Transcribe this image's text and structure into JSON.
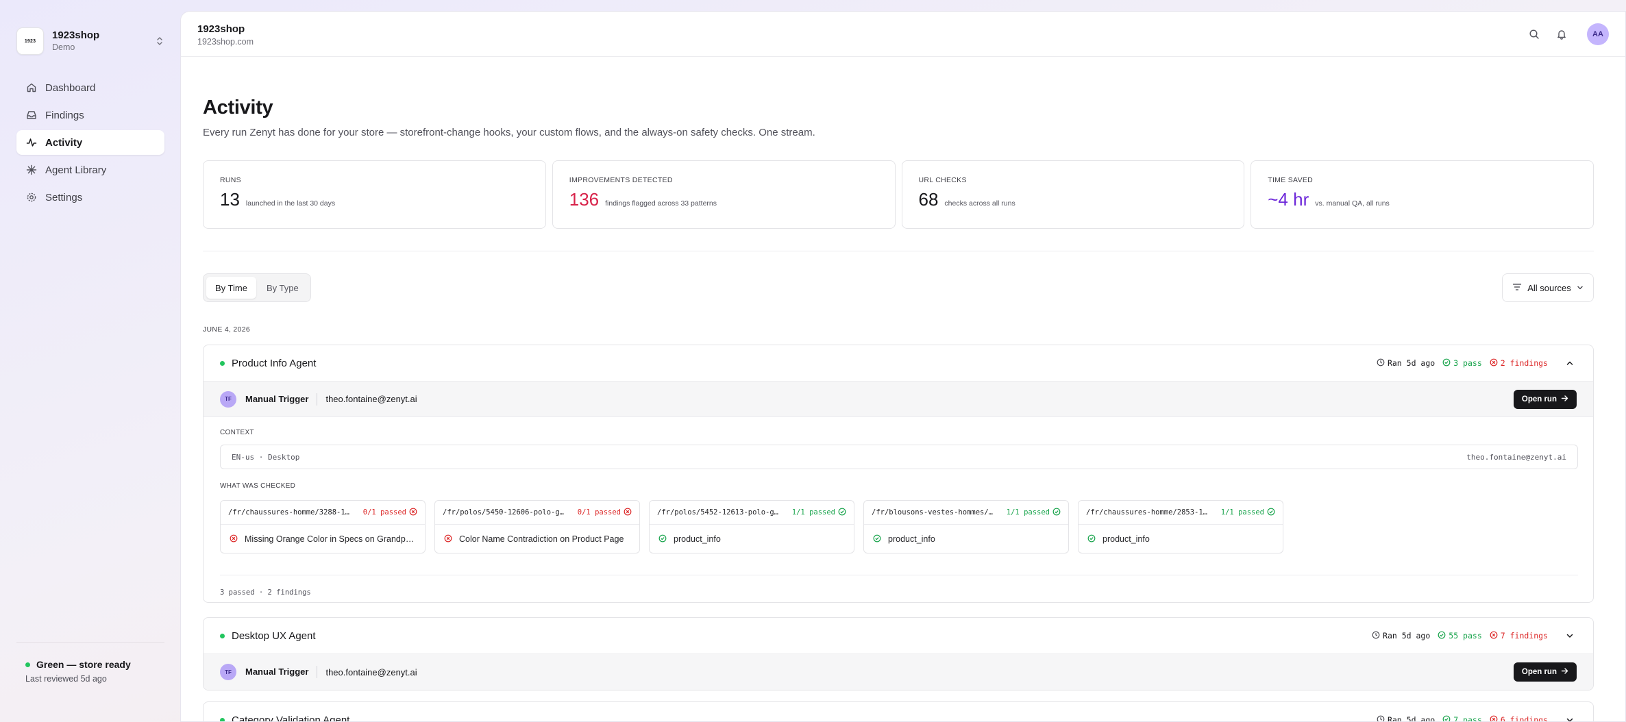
{
  "sidebar": {
    "shop_logo_text": "1923",
    "shop_name": "1923shop",
    "shop_env": "Demo",
    "items": [
      {
        "label": "Dashboard",
        "icon": "home-icon"
      },
      {
        "label": "Findings",
        "icon": "inbox-icon"
      },
      {
        "label": "Activity",
        "icon": "activity-icon",
        "active": true
      },
      {
        "label": "Agent Library",
        "icon": "agent-icon"
      },
      {
        "label": "Settings",
        "icon": "gear-icon"
      }
    ],
    "status_title": "Green — store ready",
    "status_sub": "Last reviewed 5d ago"
  },
  "topbar": {
    "title": "1923shop",
    "domain": "1923shop.com",
    "avatar": "AA"
  },
  "page": {
    "title": "Activity",
    "description": "Every run Zenyt has done for your store — storefront-change hooks, your custom flows, and the always-on safety checks. One stream."
  },
  "stats": [
    {
      "label": "RUNS",
      "value": "13",
      "note": "launched in the last 30 days",
      "color": "#18181b"
    },
    {
      "label": "IMPROVEMENTS DETECTED",
      "value": "136",
      "note": "findings flagged across 33 patterns",
      "color": "#d8234a"
    },
    {
      "label": "URL CHECKS",
      "value": "68",
      "note": "checks across all runs",
      "color": "#18181b"
    },
    {
      "label": "TIME SAVED",
      "value": "~4 hr",
      "note": "vs. manual QA, all runs",
      "color": "#6d28d9"
    }
  ],
  "view_toggle": {
    "by_time": "By Time",
    "by_type": "By Type",
    "selected": "By Time"
  },
  "filter": {
    "label": "All sources"
  },
  "date_group": "JUNE 4, 2026",
  "runs": [
    {
      "name": "Product Info Agent",
      "ran": "Ran 5d ago",
      "pass": "3 pass",
      "findings": "2 findings",
      "expanded": true,
      "trigger_initials": "TF",
      "trigger": "Manual Trigger",
      "email": "theo.fontaine@zenyt.ai",
      "open_label": "Open run",
      "context_label": "CONTEXT",
      "context_left": "EN-us · Desktop",
      "context_right": "theo.fontaine@zenyt.ai",
      "checked_label": "WHAT WAS CHECKED",
      "checks": [
        {
          "url": "/fr/chaussures-homme/3288-1…",
          "status": "0/1 passed",
          "ok": false,
          "result": "Missing Orange Color in Specs on Grandprix …"
        },
        {
          "url": "/fr/polos/5450-12606-polo-g…",
          "status": "0/1 passed",
          "ok": false,
          "result": "Color Name Contradiction on Product Page"
        },
        {
          "url": "/fr/polos/5452-12613-polo-g…",
          "status": "1/1 passed",
          "ok": true,
          "result": "product_info"
        },
        {
          "url": "/fr/blousons-vestes-hommes/…",
          "status": "1/1 passed",
          "ok": true,
          "result": "product_info"
        },
        {
          "url": "/fr/chaussures-homme/2853-1…",
          "status": "1/1 passed",
          "ok": true,
          "result": "product_info"
        }
      ],
      "summary": "3 passed · 2 findings"
    },
    {
      "name": "Desktop UX Agent",
      "ran": "Ran 5d ago",
      "pass": "55 pass",
      "findings": "7 findings",
      "expanded": false,
      "trigger_initials": "TF",
      "trigger": "Manual Trigger",
      "email": "theo.fontaine@zenyt.ai",
      "open_label": "Open run"
    },
    {
      "name": "Category Validation Agent",
      "ran": "Ran 5d ago",
      "pass": "7 pass",
      "findings": "6 findings",
      "expanded": false
    }
  ]
}
